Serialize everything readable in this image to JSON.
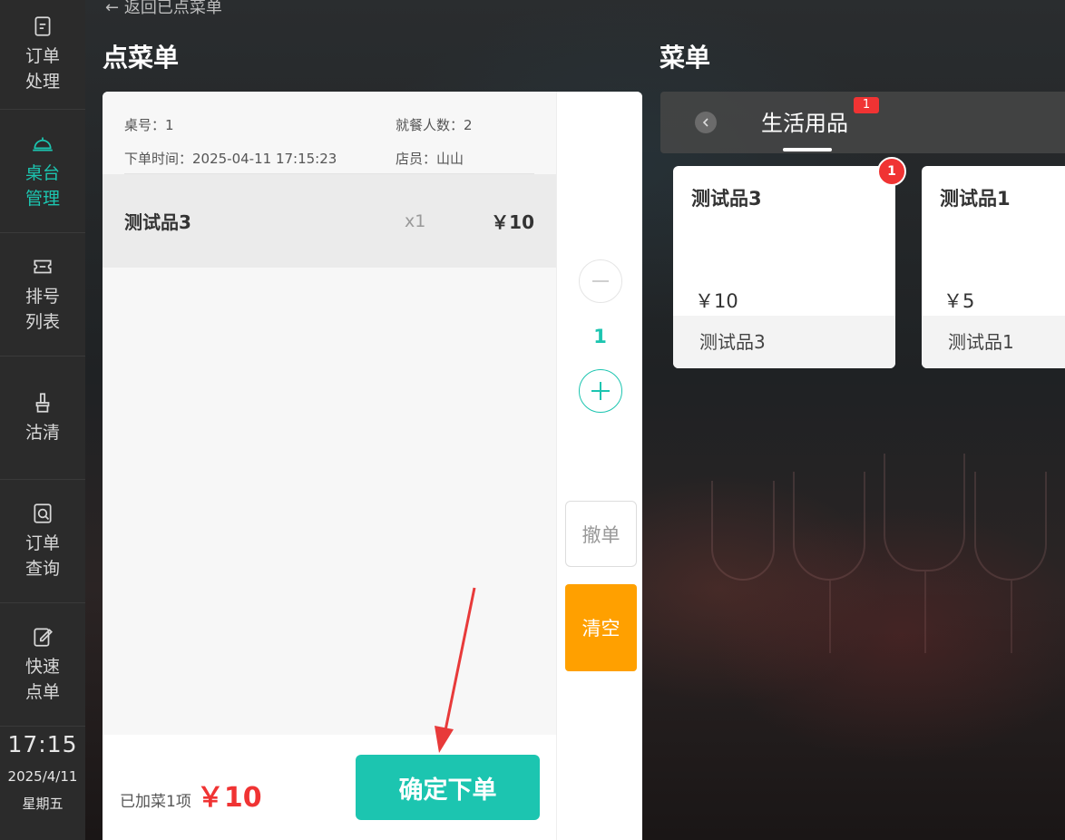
{
  "sidebar": {
    "items": [
      {
        "label": "订单\n处理",
        "icon": "file-icon"
      },
      {
        "label": "桌台\n管理",
        "icon": "bell-icon",
        "active": true
      },
      {
        "label": "排号\n列表",
        "icon": "ticket-icon"
      },
      {
        "label": "沽清",
        "icon": "brush-icon"
      },
      {
        "label": "订单\n查询",
        "icon": "search-doc-icon"
      },
      {
        "label": "快速\n点单",
        "icon": "edit-icon"
      }
    ],
    "time": "17:15",
    "date": "2025/4/11",
    "weekday": "星期五"
  },
  "header": {
    "back_label": "返回已点菜单",
    "order_title": "点菜单",
    "menu_title": "菜单"
  },
  "order": {
    "table_label": "桌号：1",
    "guests_label": "就餐人数：2",
    "time_label": "下单时间：2025-04-11 17:15:23",
    "staff_label": "店员：山山",
    "items": [
      {
        "name": "测试品3",
        "qty": "x1",
        "price": "￥10"
      }
    ],
    "summary_label": "已加菜1项",
    "total": "￥10",
    "confirm_label": "确定下单"
  },
  "controls": {
    "quantity": "1",
    "cancel_label": "撤单",
    "clear_label": "清空"
  },
  "menu": {
    "active_tab": "生活用品",
    "tab_badge": "1",
    "cards": [
      {
        "name": "测试品3",
        "price": "￥10",
        "footer": "测试品3",
        "badge": "1"
      },
      {
        "name": "测试品1",
        "price": "￥5",
        "footer": "测试品1"
      }
    ]
  },
  "colors": {
    "accent": "#1cc5b0",
    "price_red": "#f03333",
    "clear_orange": "#ffa000",
    "sidebar_bg": "#2b2b2b"
  }
}
